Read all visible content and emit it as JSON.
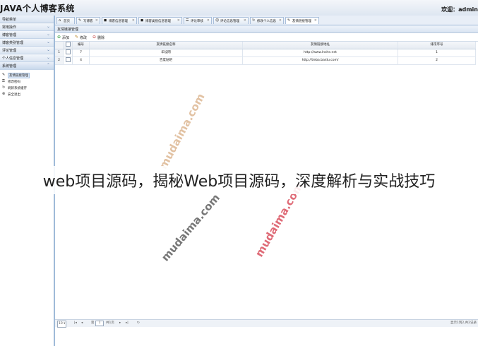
{
  "header": {
    "app_title": "JAVA个人博客系统",
    "welcome": "欢迎：admin"
  },
  "sidebar": {
    "title": "导航菜单",
    "sections": [
      {
        "label": "常用操作"
      },
      {
        "label": "博客管理"
      },
      {
        "label": "博客类别管理"
      },
      {
        "label": "评论管理"
      },
      {
        "label": "个人信息管理"
      },
      {
        "label": "系统管理"
      }
    ],
    "system_items": [
      {
        "icon": "✎",
        "label": "友情链接管理"
      },
      {
        "icon": "⚿",
        "label": "修改密码"
      },
      {
        "icon": "↻",
        "label": "刷新系统缓存"
      },
      {
        "icon": "⊗",
        "label": "安全退出"
      }
    ]
  },
  "tabs": [
    {
      "icon": "⌂",
      "label": "首页",
      "closable": false
    },
    {
      "icon": "✎",
      "label": "写博客",
      "closable": true
    },
    {
      "icon": "◼",
      "label": "博客信息管理",
      "closable": true
    },
    {
      "icon": "◼",
      "label": "博客类别信息管理",
      "closable": true
    },
    {
      "icon": "☰",
      "label": "评论审核",
      "closable": true
    },
    {
      "icon": "☺",
      "label": "评论信息管理",
      "closable": true
    },
    {
      "icon": "↻",
      "label": "修改个人信息",
      "closable": true
    },
    {
      "icon": "✎",
      "label": "友情链接管理",
      "closable": true
    }
  ],
  "panel": {
    "title": "友情链接管理",
    "toolbar": {
      "add": "添加",
      "edit": "修改",
      "delete": "删除"
    }
  },
  "table": {
    "columns": [
      "编号",
      "友情链接名称",
      "友情链接地址",
      "排序序号"
    ],
    "rows": [
      {
        "num": "1",
        "id": "7",
        "name": "华设网",
        "url": "http://www.lnshe.net",
        "sort": "1"
      },
      {
        "num": "2",
        "id": "4",
        "name": "百度贴吧",
        "url": "http://tieba.baidu.com/",
        "sort": "2"
      }
    ]
  },
  "pager": {
    "page_size": "10",
    "page_label": "第",
    "page_value": "1",
    "total_label": "共1页",
    "display_text": "显示1到2,共2记录"
  },
  "watermark": {
    "text": "mudaima.com"
  },
  "overlay": {
    "title": "web项目源码，揭秘Web项目源码，深度解析与实战技巧"
  },
  "colors": {
    "accent": "#9fbad8",
    "header_bg": "#dde6f1"
  }
}
